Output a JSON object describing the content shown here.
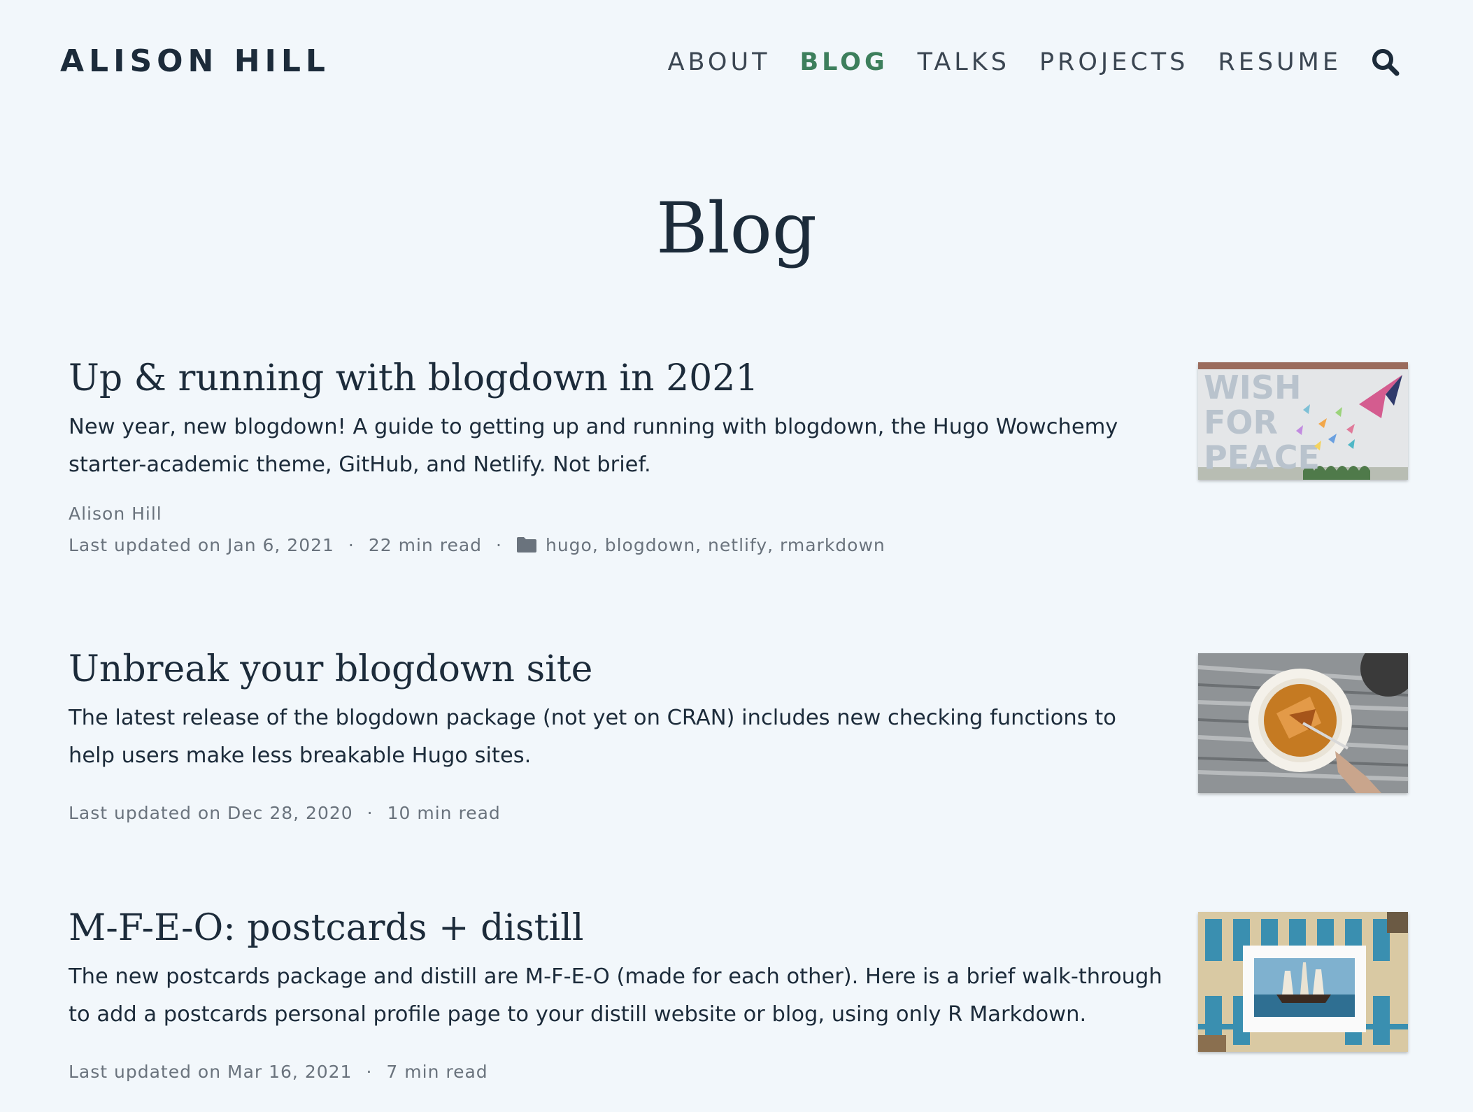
{
  "header": {
    "brand": "ALISON HILL",
    "nav": [
      {
        "label": "ABOUT",
        "active": false
      },
      {
        "label": "BLOG",
        "active": true
      },
      {
        "label": "TALKS",
        "active": false
      },
      {
        "label": "PROJECTS",
        "active": false
      },
      {
        "label": "RESUME",
        "active": false
      }
    ],
    "search_icon": "search-icon"
  },
  "page": {
    "title": "Blog"
  },
  "posts": [
    {
      "title": "Up & running with blogdown in 2021",
      "summary": "New year, new blogdown! A guide to getting up and running with blogdown, the Hugo Wowchemy starter-academic theme, GitHub, and Netlify. Not brief.",
      "author": "Alison Hill",
      "date": "Last updated on Jan 6, 2021",
      "separator": "·",
      "read_time": "22 min read",
      "categories": "hugo, blogdown, netlify, rmarkdown",
      "thumbnail": "wish-for-peace-mural-image",
      "thumbnail_text": "WISH FOR PEACE"
    },
    {
      "title": "Unbreak your blogdown site",
      "summary": "The latest release of the blogdown package (not yet on CRAN) includes new checking functions to help users make less breakable Hugo sites.",
      "date": "Last updated on Dec 28, 2020",
      "separator": "·",
      "read_time": "10 min read",
      "thumbnail": "creme-brulee-image"
    },
    {
      "title": "M-F-E-O: postcards + distill",
      "summary": "The new postcards package and distill are M-F-E-O (made for each other). Here is a brief walk-through to add a postcards personal profile page to your distill website or blog, using only R Markdown.",
      "date": "Last updated on Mar 16, 2021",
      "separator": "·",
      "read_time": "7 min read",
      "thumbnail": "postcard-ship-image"
    }
  ],
  "colors": {
    "background": "#f2f7fb",
    "text": "#1c2b3a",
    "accent": "#3d7f5c",
    "meta": "#6a737d"
  }
}
